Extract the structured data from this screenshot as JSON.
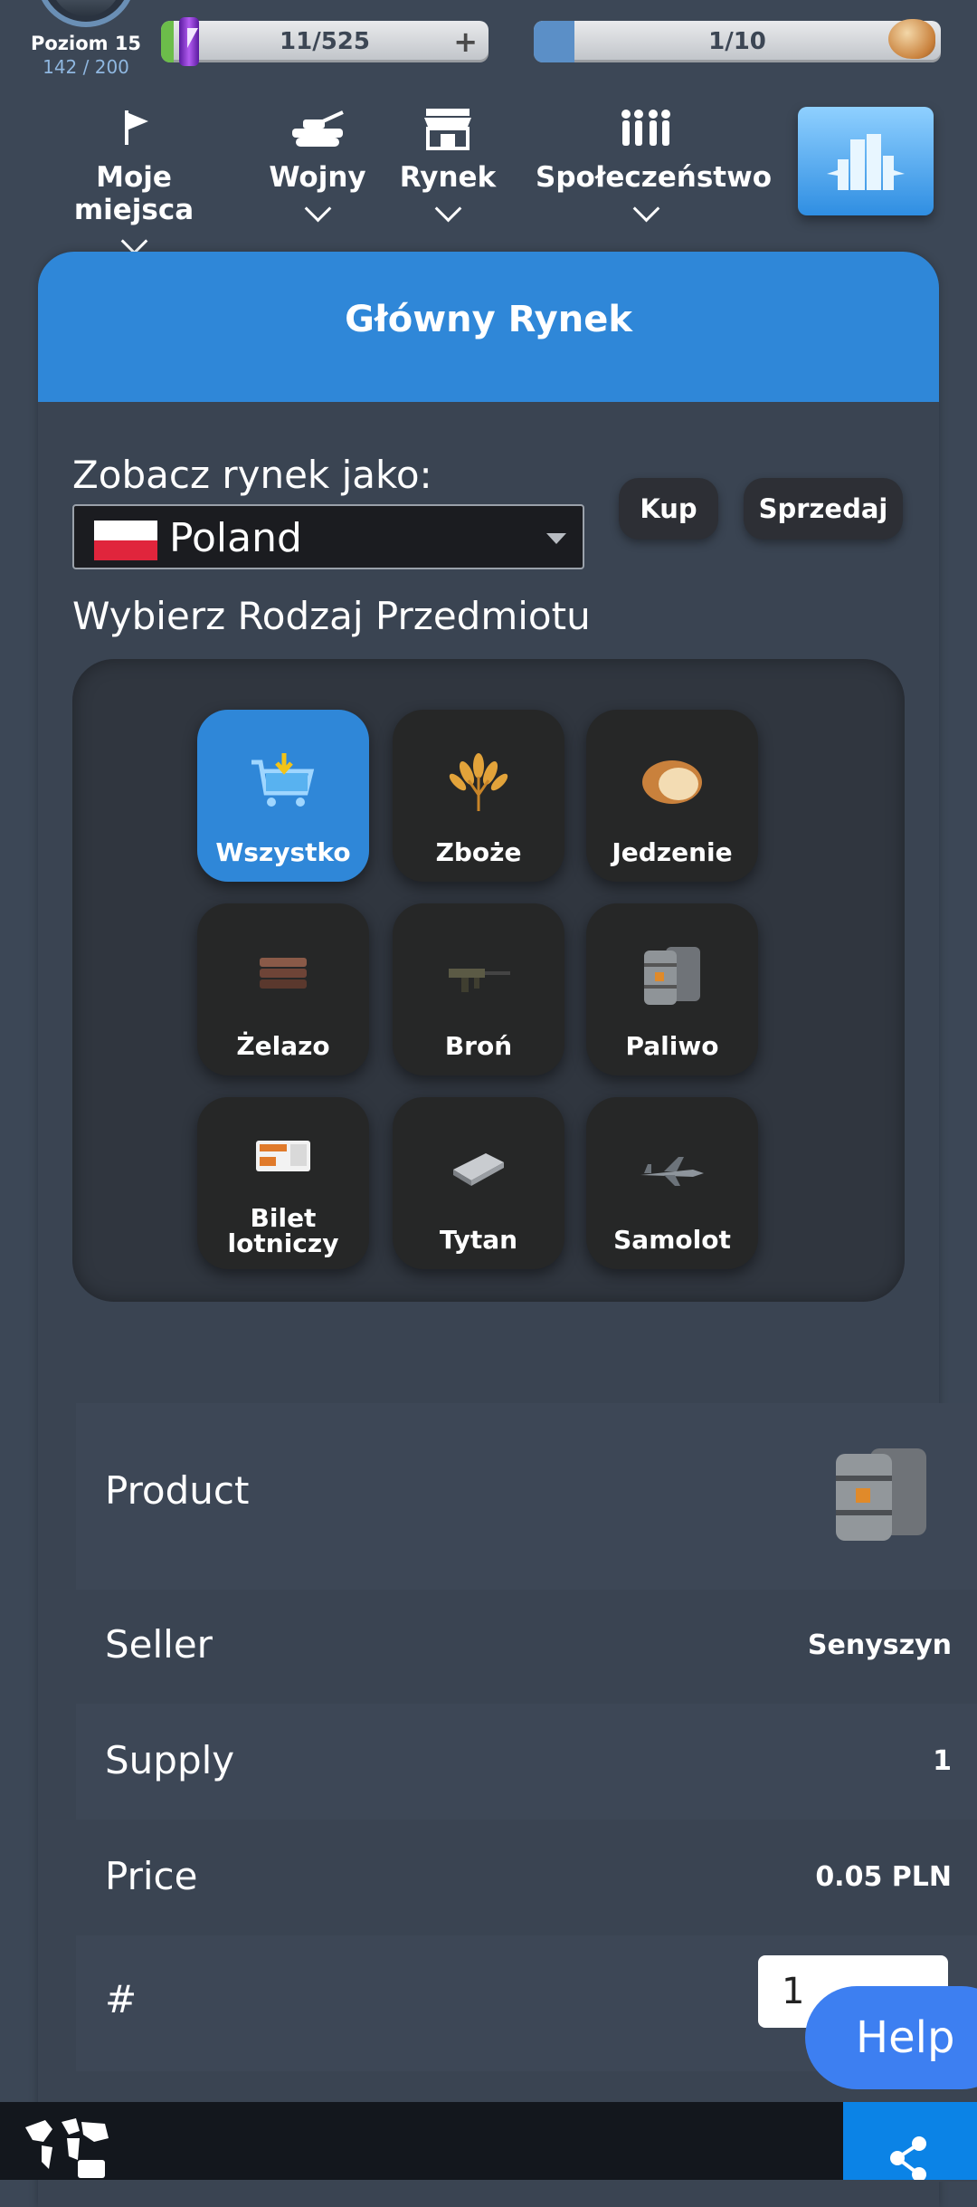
{
  "player": {
    "level_label": "Poziom 15",
    "xp": "142 / 200"
  },
  "resources": {
    "energy": "11/525",
    "energy_fill_fraction": 0.02,
    "food": "1/10",
    "food_fill_fraction": 0.1
  },
  "nav": [
    {
      "label": "Moje miejsca",
      "icon": "flag-icon"
    },
    {
      "label": "Wojny",
      "icon": "tank-icon"
    },
    {
      "label": "Rynek",
      "icon": "store-icon"
    },
    {
      "label": "Społeczeństwo",
      "icon": "people-icon"
    }
  ],
  "city_button_icon": "city-buildings-icon",
  "market": {
    "title": "Główny Rynek",
    "see_as_label": "Zobacz rynek jako:",
    "country": "Poland",
    "buy_label": "Kup",
    "sell_label": "Sprzedaj",
    "item_type_label": "Wybierz Rodzaj Przedmiotu",
    "items": [
      {
        "label": "Wszystko",
        "icon": "cart-icon",
        "active": true
      },
      {
        "label": "Zboże",
        "icon": "grain-icon"
      },
      {
        "label": "Jedzenie",
        "icon": "bread-icon"
      },
      {
        "label": "Żelazo",
        "icon": "iron-icon"
      },
      {
        "label": "Broń",
        "icon": "rifle-icon"
      },
      {
        "label": "Paliwo",
        "icon": "fuel-barrels-icon"
      },
      {
        "label": "Bilet lotniczy",
        "icon": "ticket-icon"
      },
      {
        "label": "Tytan",
        "icon": "titanium-icon"
      },
      {
        "label": "Samolot",
        "icon": "jet-icon"
      }
    ]
  },
  "offer": {
    "product_label": "Product",
    "product_icon": "fuel-barrels-icon",
    "seller_label": "Seller",
    "seller": "Senyszyn",
    "supply_label": "Supply",
    "supply": "1",
    "price_label": "Price",
    "price": "0.05 PLN",
    "qty_label": "#",
    "qty_value": "1"
  },
  "help_label": "Help",
  "bottom_bar": {
    "map_icon": "world-map-icon",
    "share_icon": "share-icon"
  }
}
